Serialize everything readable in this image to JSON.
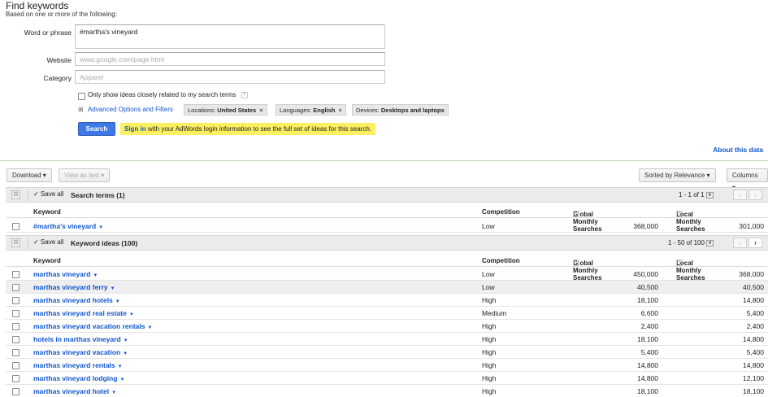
{
  "title": "Find keywords",
  "subtitle": "Based on one or more of the following:",
  "form": {
    "word_label": "Word or phrase",
    "word_value": "#martha's vineyard",
    "website_label": "Website",
    "website_placeholder": "www.google.com/page.html",
    "category_label": "Category",
    "category_placeholder": "Apparel",
    "only_related_label": "Only show ideas closely related to my search terms",
    "help": "?",
    "advanced_toggle": "⊞",
    "advanced_label": "Advanced Options and Filters",
    "chips": [
      {
        "name": "Locations:",
        "value": "United States"
      },
      {
        "name": "Languages:",
        "value": "English"
      },
      {
        "name": "Devices:",
        "value": "Desktops and laptops"
      }
    ],
    "search_button": "Search",
    "notice_link": "Sign in",
    "notice_text": "with your AdWords login information to see the full set of ideas for this search."
  },
  "about_link": "About this data",
  "toolbar": {
    "download": "Download ▾",
    "view_as_text": "View as text ▾",
    "sorted": "Sorted by Relevance ▾",
    "columns": "Columns ▾"
  },
  "search_terms": {
    "toggle": "⊟",
    "save_all": "✓ Save all",
    "title": "Search terms (1)",
    "pager": "1 - 1 of 1",
    "prev": "‹",
    "next": "›"
  },
  "columns": {
    "keyword": "Keyword",
    "competition": "Competition",
    "global": "Global Monthly Searches",
    "local": "Local Monthly Searches"
  },
  "search_term_rows": [
    {
      "keyword": "#martha's vineyard",
      "competition": "Low",
      "global": "368,000",
      "local": "301,000"
    }
  ],
  "keyword_ideas": {
    "toggle": "⊟",
    "save_all": "✓ Save all",
    "title": "Keyword ideas (100)",
    "pager": "1 - 50 of 100",
    "prev": "‹",
    "next": "›"
  },
  "idea_rows": [
    {
      "keyword": "marthas vineyard",
      "competition": "Low",
      "global": "450,000",
      "local": "368,000"
    },
    {
      "keyword": "marthas vineyard ferry",
      "competition": "Low",
      "global": "40,500",
      "local": "40,500"
    },
    {
      "keyword": "marthas vineyard hotels",
      "competition": "High",
      "global": "18,100",
      "local": "14,800"
    },
    {
      "keyword": "marthas vineyard real estate",
      "competition": "Medium",
      "global": "6,600",
      "local": "5,400"
    },
    {
      "keyword": "marthas vineyard vacation rentals",
      "competition": "High",
      "global": "2,400",
      "local": "2,400"
    },
    {
      "keyword": "hotels in marthas vineyard",
      "competition": "High",
      "global": "18,100",
      "local": "14,800"
    },
    {
      "keyword": "marthas vineyard vacation",
      "competition": "High",
      "global": "5,400",
      "local": "5,400"
    },
    {
      "keyword": "marthas vineyard rentals",
      "competition": "High",
      "global": "14,800",
      "local": "14,800"
    },
    {
      "keyword": "marthas vineyard lodging",
      "competition": "High",
      "global": "14,800",
      "local": "12,100"
    },
    {
      "keyword": "marthas vineyard hotel",
      "competition": "High",
      "global": "18,100",
      "local": "18,100"
    }
  ]
}
